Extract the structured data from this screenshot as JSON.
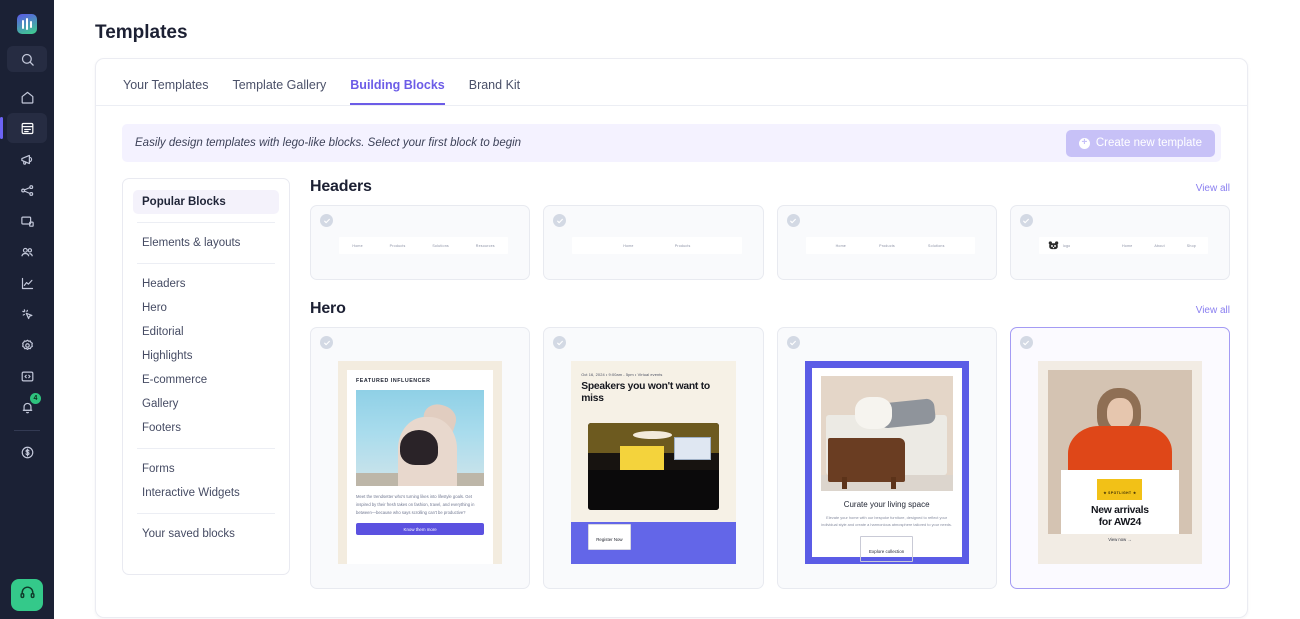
{
  "rail": {
    "logo_name": "app-logo",
    "search_label": "Search",
    "notification_count": "4",
    "items": [
      {
        "name": "home",
        "label": "Home"
      },
      {
        "name": "templates",
        "label": "Templates"
      },
      {
        "name": "campaigns",
        "label": "Campaigns"
      },
      {
        "name": "automations",
        "label": "Automations"
      },
      {
        "name": "landing-pages",
        "label": "Landing Pages"
      },
      {
        "name": "audience",
        "label": "Audience"
      },
      {
        "name": "analytics",
        "label": "Analytics"
      },
      {
        "name": "integrations",
        "label": "Integrations"
      },
      {
        "name": "settings",
        "label": "Settings"
      },
      {
        "name": "developers",
        "label": "Developers"
      },
      {
        "name": "notifications",
        "label": "Notifications"
      },
      {
        "name": "billing",
        "label": "Billing"
      }
    ],
    "support_label": "Support"
  },
  "page": {
    "title": "Templates"
  },
  "tabs": [
    {
      "label": "Your Templates",
      "active": false
    },
    {
      "label": "Template Gallery",
      "active": false
    },
    {
      "label": "Building Blocks",
      "active": true
    },
    {
      "label": "Brand Kit",
      "active": false
    }
  ],
  "notice": {
    "text": "Easily design templates with lego-like blocks. Select your first block to begin",
    "button_label": "Create new template",
    "button_icon": "plus-circle-icon",
    "button_color": "#c7c1f7",
    "background": "#f4f2ff"
  },
  "categories": [
    {
      "label": "Popular Blocks",
      "selected": true,
      "divider_after": true
    },
    {
      "label": "Elements & layouts",
      "selected": false,
      "divider_after": true
    },
    {
      "label": "Headers",
      "selected": false,
      "divider_after": false
    },
    {
      "label": "Hero",
      "selected": false,
      "divider_after": false
    },
    {
      "label": "Editorial",
      "selected": false,
      "divider_after": false
    },
    {
      "label": "Highlights",
      "selected": false,
      "divider_after": false
    },
    {
      "label": "E-commerce",
      "selected": false,
      "divider_after": false
    },
    {
      "label": "Gallery",
      "selected": false,
      "divider_after": false
    },
    {
      "label": "Footers",
      "selected": false,
      "divider_after": true
    },
    {
      "label": "Forms",
      "selected": false,
      "divider_after": false
    },
    {
      "label": "Interactive Widgets",
      "selected": false,
      "divider_after": true
    },
    {
      "label": "Your saved blocks",
      "selected": false,
      "divider_after": false
    }
  ],
  "sections": {
    "headers": {
      "title": "Headers",
      "view_all": "View all",
      "cards": [
        {
          "nav": [
            "Home",
            "Products",
            "Solutions",
            "Resources"
          ],
          "has_logo": false,
          "selected": false
        },
        {
          "nav": [
            "Home",
            "Products"
          ],
          "has_logo": false,
          "selected": false
        },
        {
          "nav": [
            "Home",
            "Products",
            "Solutions"
          ],
          "has_logo": false,
          "selected": false
        },
        {
          "nav": [
            "Home",
            "About",
            "Shop"
          ],
          "has_logo": true,
          "logo_word": "logo",
          "selected": false
        }
      ]
    },
    "hero": {
      "title": "Hero",
      "view_all": "View all",
      "cards": [
        {
          "id": "featured-influencer",
          "kicker": "FEATURED INFLUENCER",
          "body": "Meet the trendsetter who's turning likes into lifestyle goals. Get inspired by their fresh takes on fashion, travel, and everything in between—because who says scrolling can't be productive?",
          "button": "Know them more",
          "selected": false
        },
        {
          "id": "speakers-event",
          "meta": "Oct 16, 2024  •  9:00am - 5pm  •  Virtual events",
          "title": "Speakers you won't want to miss",
          "button": "Register Now",
          "selected": false
        },
        {
          "id": "living-space",
          "title": "Curate your living space",
          "body": "Elevate your home with our bespoke furniture, designed to reflect your individual style and create a harmonious atmosphere tailored to your needs.",
          "button": "Explore collection",
          "selected": false
        },
        {
          "id": "new-arrivals",
          "badge": "★ SPOTLIGHT ★",
          "title": "New arrivals\nfor AW24",
          "link": "View now  →",
          "selected": true
        }
      ]
    }
  }
}
